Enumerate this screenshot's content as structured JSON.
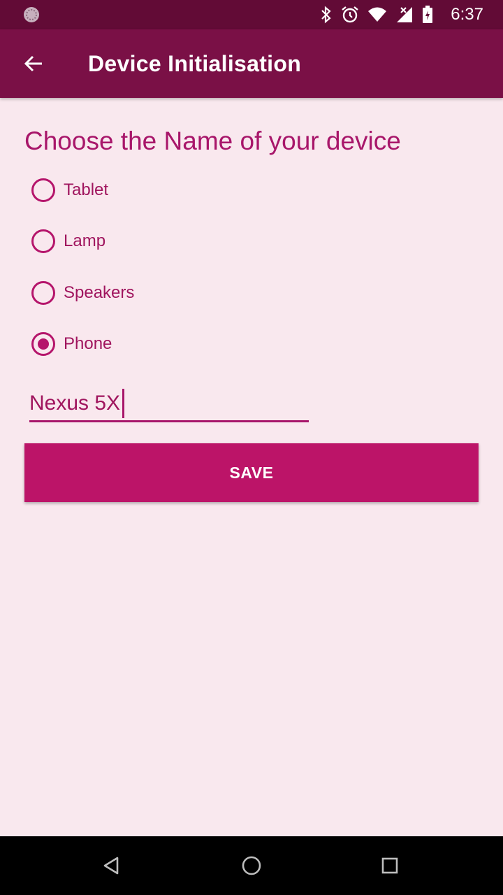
{
  "status_bar": {
    "time": "6:37",
    "icons": [
      "app-notification-icon",
      "bluetooth-icon",
      "alarm-icon",
      "wifi-icon",
      "no-signal-icon",
      "battery-charging-icon"
    ]
  },
  "app_bar": {
    "title": "Device Initialisation",
    "back_icon": "arrow-back-icon"
  },
  "form": {
    "heading": "Choose the Name of your device",
    "options": [
      {
        "label": "Tablet",
        "checked": false
      },
      {
        "label": "Lamp",
        "checked": false
      },
      {
        "label": "Speakers",
        "checked": false
      },
      {
        "label": "Phone",
        "checked": true
      }
    ],
    "name_value": "Nexus 5X",
    "save_label": "SAVE"
  },
  "nav_bar": {
    "icons": [
      "back-triangle-icon",
      "home-circle-icon",
      "recents-square-icon"
    ]
  },
  "colors": {
    "status_bar": "#620b36",
    "app_bar": "#7a1046",
    "accent": "#bc1468",
    "background": "#f9e8ee"
  }
}
